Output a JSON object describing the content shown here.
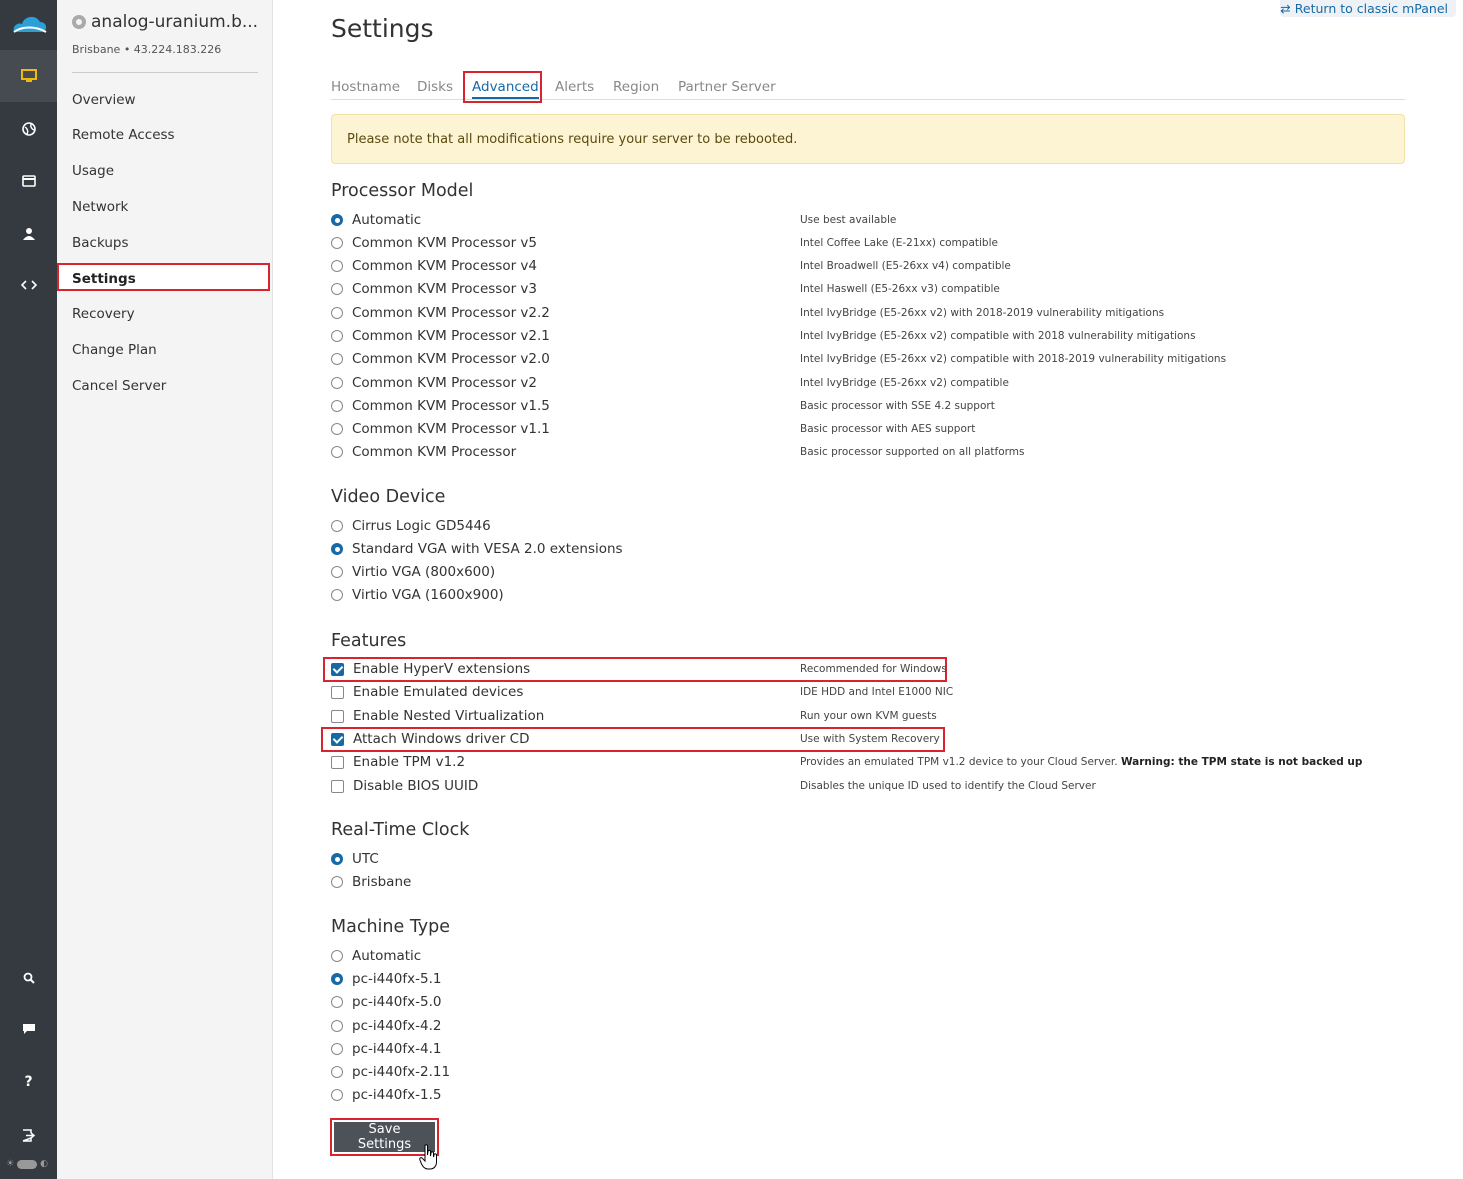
{
  "server": {
    "name": "analog-uranium.b...",
    "subtitle": "Brisbane • 43.224.183.226"
  },
  "sidenav": {
    "items": [
      "Overview",
      "Remote Access",
      "Usage",
      "Network",
      "Backups",
      "Settings",
      "Recovery",
      "Change Plan",
      "Cancel Server"
    ],
    "active": "Settings"
  },
  "classic_link": "Return to classic mPanel",
  "page_title": "Settings",
  "tabs": {
    "items": [
      "Hostname",
      "Disks",
      "Advanced",
      "Alerts",
      "Region",
      "Partner Server"
    ],
    "active": "Advanced"
  },
  "notice": "Please note that all modifications require your server to be rebooted.",
  "processor": {
    "title": "Processor Model",
    "options": [
      {
        "label": "Automatic",
        "desc": "Use best available",
        "selected": true
      },
      {
        "label": "Common KVM Processor v5",
        "desc": "Intel Coffee Lake (E-21xx) compatible",
        "selected": false
      },
      {
        "label": "Common KVM Processor v4",
        "desc": "Intel Broadwell (E5-26xx v4) compatible",
        "selected": false
      },
      {
        "label": "Common KVM Processor v3",
        "desc": "Intel Haswell (E5-26xx v3) compatible",
        "selected": false
      },
      {
        "label": "Common KVM Processor v2.2",
        "desc": "Intel IvyBridge (E5-26xx v2) with 2018-2019 vulnerability mitigations",
        "selected": false
      },
      {
        "label": "Common KVM Processor v2.1",
        "desc": "Intel IvyBridge (E5-26xx v2) compatible with 2018 vulnerability mitigations",
        "selected": false
      },
      {
        "label": "Common KVM Processor v2.0",
        "desc": "Intel IvyBridge (E5-26xx v2) compatible with 2018-2019 vulnerability mitigations",
        "selected": false
      },
      {
        "label": "Common KVM Processor v2",
        "desc": "Intel IvyBridge (E5-26xx v2) compatible",
        "selected": false
      },
      {
        "label": "Common KVM Processor v1.5",
        "desc": "Basic processor with SSE 4.2 support",
        "selected": false
      },
      {
        "label": "Common KVM Processor v1.1",
        "desc": "Basic processor with AES support",
        "selected": false
      },
      {
        "label": "Common KVM Processor",
        "desc": "Basic processor supported on all platforms",
        "selected": false
      }
    ]
  },
  "video": {
    "title": "Video Device",
    "options": [
      {
        "label": "Cirrus Logic GD5446",
        "selected": false
      },
      {
        "label": "Standard VGA with VESA 2.0 extensions",
        "selected": true
      },
      {
        "label": "Virtio VGA (800x600)",
        "selected": false
      },
      {
        "label": "Virtio VGA (1600x900)",
        "selected": false
      }
    ]
  },
  "features": {
    "title": "Features",
    "options": [
      {
        "label": "Enable HyperV extensions",
        "desc": "Recommended for Windows",
        "checked": true
      },
      {
        "label": "Enable Emulated devices",
        "desc": "IDE HDD and Intel E1000 NIC",
        "checked": false
      },
      {
        "label": "Enable Nested Virtualization",
        "desc": "Run your own KVM guests",
        "checked": false
      },
      {
        "label": "Attach Windows driver CD",
        "desc": "Use with System Recovery",
        "checked": true
      },
      {
        "label": "Enable TPM v1.2",
        "desc": "Provides an emulated TPM v1.2 device to your Cloud Server.",
        "desc_bold": "Warning: the TPM state is not backed up",
        "checked": false
      },
      {
        "label": "Disable BIOS UUID",
        "desc": "Disables the unique ID used to identify the Cloud Server",
        "checked": false
      }
    ]
  },
  "clock": {
    "title": "Real-Time Clock",
    "options": [
      {
        "label": "UTC",
        "selected": true
      },
      {
        "label": "Brisbane",
        "selected": false
      }
    ]
  },
  "machine": {
    "title": "Machine Type",
    "options": [
      {
        "label": "Automatic",
        "selected": false
      },
      {
        "label": "pc-i440fx-5.1",
        "selected": true
      },
      {
        "label": "pc-i440fx-5.0",
        "selected": false
      },
      {
        "label": "pc-i440fx-4.2",
        "selected": false
      },
      {
        "label": "pc-i440fx-4.1",
        "selected": false
      },
      {
        "label": "pc-i440fx-2.11",
        "selected": false
      },
      {
        "label": "pc-i440fx-1.5",
        "selected": false
      }
    ]
  },
  "save_label": "Save Settings",
  "colors": {
    "accent": "#1769a6",
    "highlight": "#d9232e",
    "rail": "#343a40",
    "notice_bg": "#fcf4d2"
  },
  "rail_icons": [
    "cloud-logo-icon",
    "server-icon",
    "globe-icon",
    "card-icon",
    "user-icon",
    "code-icon",
    "search-icon",
    "chat-icon",
    "help-icon",
    "logout-icon"
  ]
}
